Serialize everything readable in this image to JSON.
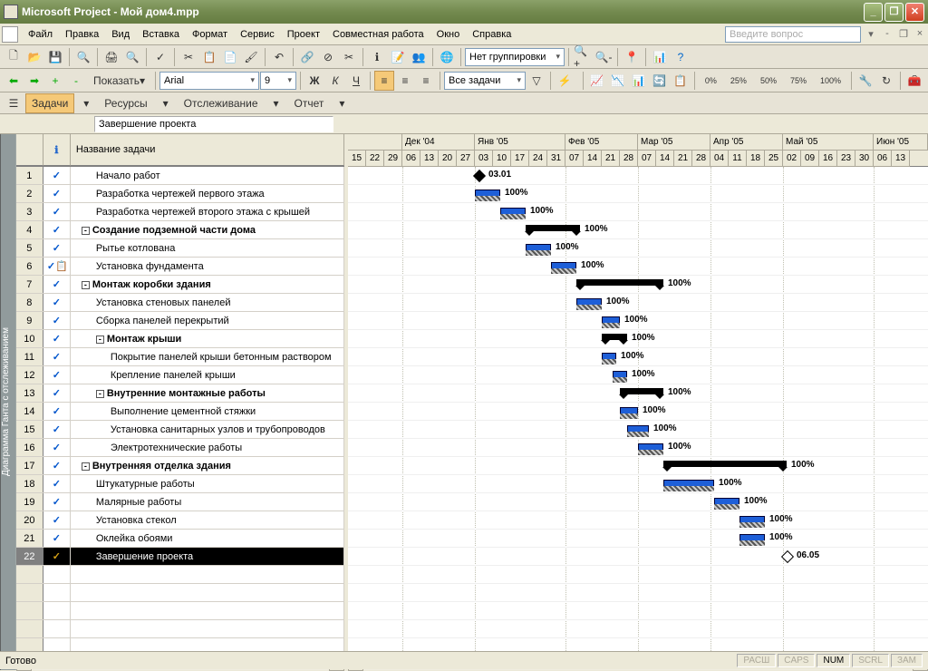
{
  "titlebar": {
    "app": "Microsoft Project",
    "file": "Мой дом4.mpp"
  },
  "menu": [
    "Файл",
    "Правка",
    "Вид",
    "Вставка",
    "Формат",
    "Сервис",
    "Проект",
    "Совместная работа",
    "Окно",
    "Справка"
  ],
  "help_placeholder": "Введите вопрос",
  "toolbar2": {
    "show_label": "Показать",
    "font": "Arial",
    "size": "9",
    "group": "Нет группировки",
    "filter": "Все задачи"
  },
  "percent_buttons": [
    "0%",
    "25%",
    "50%",
    "75%",
    "100%"
  ],
  "viewbar": {
    "tasks": "Задачи",
    "resources": "Ресурсы",
    "tracking": "Отслеживание",
    "report": "Отчет"
  },
  "entry_value": "Завершение проекта",
  "grid": {
    "col_info": "ℹ",
    "col_name": "Название задачи"
  },
  "side_label": "Диаграмма Ганта с отслеживанием",
  "timeline": {
    "months": [
      {
        "label": "",
        "span": 3
      },
      {
        "label": "Дек '04",
        "span": 4
      },
      {
        "label": "Янв '05",
        "span": 5
      },
      {
        "label": "Фев '05",
        "span": 4
      },
      {
        "label": "Мар '05",
        "span": 4
      },
      {
        "label": "Апр '05",
        "span": 4
      },
      {
        "label": "Май '05",
        "span": 5
      },
      {
        "label": "Июн '05",
        "span": 3
      }
    ],
    "days": [
      "15",
      "22",
      "29",
      "06",
      "13",
      "20",
      "27",
      "03",
      "10",
      "17",
      "24",
      "31",
      "07",
      "14",
      "21",
      "28",
      "07",
      "14",
      "21",
      "28",
      "04",
      "11",
      "18",
      "25",
      "02",
      "09",
      "16",
      "23",
      "30",
      "06",
      "13"
    ],
    "day_width": 20
  },
  "tasks": [
    {
      "id": 1,
      "name": "Начало работ",
      "indent": 1,
      "bold": false,
      "type": "milestone",
      "start": 7,
      "label": "03.01"
    },
    {
      "id": 2,
      "name": "Разработка чертежей первого этажа",
      "indent": 1,
      "bold": false,
      "type": "task",
      "start": 7,
      "dur": 1.4,
      "pct": "100%"
    },
    {
      "id": 3,
      "name": "Разработка чертежей второго этажа с крышей",
      "indent": 1,
      "bold": false,
      "type": "task",
      "start": 8.4,
      "dur": 1.4,
      "pct": "100%"
    },
    {
      "id": 4,
      "name": "Создание подземной части дома",
      "indent": 0,
      "bold": true,
      "type": "summary",
      "start": 9.8,
      "dur": 3.0,
      "pct": "100%",
      "outline": "-"
    },
    {
      "id": 5,
      "name": "Рытье котлована",
      "indent": 1,
      "bold": false,
      "type": "task",
      "start": 9.8,
      "dur": 1.4,
      "pct": "100%"
    },
    {
      "id": 6,
      "name": "Установка фундамента",
      "indent": 1,
      "bold": false,
      "type": "task",
      "start": 11.2,
      "dur": 1.4,
      "pct": "100%",
      "icon": "note"
    },
    {
      "id": 7,
      "name": "Монтаж коробки здания",
      "indent": 0,
      "bold": true,
      "type": "summary",
      "start": 12.6,
      "dur": 4.8,
      "pct": "100%",
      "outline": "-"
    },
    {
      "id": 8,
      "name": "Установка стеновых панелей",
      "indent": 1,
      "bold": false,
      "type": "task",
      "start": 12.6,
      "dur": 1.4,
      "pct": "100%"
    },
    {
      "id": 9,
      "name": "Сборка панелей перекрытий",
      "indent": 1,
      "bold": false,
      "type": "task",
      "start": 14.0,
      "dur": 1.0,
      "pct": "100%"
    },
    {
      "id": 10,
      "name": "Монтаж крыши",
      "indent": 1,
      "bold": true,
      "type": "summary",
      "start": 14.0,
      "dur": 1.4,
      "pct": "100%",
      "outline": "-"
    },
    {
      "id": 11,
      "name": "Покрытие панелей крыши бетонным раствором",
      "indent": 2,
      "bold": false,
      "type": "task",
      "start": 14.0,
      "dur": 0.8,
      "pct": "100%"
    },
    {
      "id": 12,
      "name": "Крепление панелей крыши",
      "indent": 2,
      "bold": false,
      "type": "task",
      "start": 14.6,
      "dur": 0.8,
      "pct": "100%"
    },
    {
      "id": 13,
      "name": "Внутренние монтажные работы",
      "indent": 1,
      "bold": true,
      "type": "summary",
      "start": 15.0,
      "dur": 2.4,
      "pct": "100%",
      "outline": "-"
    },
    {
      "id": 14,
      "name": "Выполнение цементной стяжки",
      "indent": 2,
      "bold": false,
      "type": "task",
      "start": 15.0,
      "dur": 1.0,
      "pct": "100%"
    },
    {
      "id": 15,
      "name": "Установка санитарных узлов и трубопроводов",
      "indent": 2,
      "bold": false,
      "type": "task",
      "start": 15.4,
      "dur": 1.2,
      "pct": "100%"
    },
    {
      "id": 16,
      "name": "Электротехнические работы",
      "indent": 2,
      "bold": false,
      "type": "task",
      "start": 16.0,
      "dur": 1.4,
      "pct": "100%"
    },
    {
      "id": 17,
      "name": "Внутренняя отделка здания",
      "indent": 0,
      "bold": true,
      "type": "summary",
      "start": 17.4,
      "dur": 6.8,
      "pct": "100%",
      "outline": "-"
    },
    {
      "id": 18,
      "name": "Штукатурные работы",
      "indent": 1,
      "bold": false,
      "type": "task",
      "start": 17.4,
      "dur": 2.8,
      "pct": "100%"
    },
    {
      "id": 19,
      "name": "Малярные работы",
      "indent": 1,
      "bold": false,
      "type": "task",
      "start": 20.2,
      "dur": 1.4,
      "pct": "100%"
    },
    {
      "id": 20,
      "name": "Установка стекол",
      "indent": 1,
      "bold": false,
      "type": "task",
      "start": 21.6,
      "dur": 1.4,
      "pct": "100%"
    },
    {
      "id": 21,
      "name": "Оклейка обоями",
      "indent": 1,
      "bold": false,
      "type": "task",
      "start": 21.6,
      "dur": 1.4,
      "pct": "100%"
    },
    {
      "id": 22,
      "name": "Завершение проекта",
      "indent": 1,
      "bold": false,
      "type": "milestone",
      "start": 24.0,
      "label": "06.05",
      "selected": true
    }
  ],
  "statusbar": {
    "ready": "Готово",
    "ext": "РАСШ",
    "caps": "CAPS",
    "num": "NUM",
    "scrl": "SCRL",
    "ovr": "ЗАМ"
  },
  "chart_data": {
    "type": "gantt",
    "title": "Диаграмма Ганта с отслеживанием — Мой дом4.mpp",
    "time_axis": {
      "start": "2004-11-15",
      "end": "2005-06-13",
      "unit": "week"
    },
    "tasks": [
      {
        "id": 1,
        "name": "Начало работ",
        "type": "milestone",
        "date": "2005-01-03",
        "complete": 100
      },
      {
        "id": 2,
        "name": "Разработка чертежей первого этажа",
        "type": "task",
        "start": "2005-01-03",
        "end": "2005-01-12",
        "complete": 100
      },
      {
        "id": 3,
        "name": "Разработка чертежей второго этажа с крышей",
        "type": "task",
        "start": "2005-01-12",
        "end": "2005-01-21",
        "complete": 100
      },
      {
        "id": 4,
        "name": "Создание подземной части дома",
        "type": "summary",
        "start": "2005-01-21",
        "end": "2005-02-11",
        "complete": 100
      },
      {
        "id": 5,
        "name": "Рытье котлована",
        "type": "task",
        "start": "2005-01-21",
        "end": "2005-01-31",
        "complete": 100
      },
      {
        "id": 6,
        "name": "Установка фундамента",
        "type": "task",
        "start": "2005-01-31",
        "end": "2005-02-11",
        "complete": 100
      },
      {
        "id": 7,
        "name": "Монтаж коробки здания",
        "type": "summary",
        "start": "2005-02-11",
        "end": "2005-03-17",
        "complete": 100
      },
      {
        "id": 8,
        "name": "Установка стеновых панелей",
        "type": "task",
        "start": "2005-02-11",
        "end": "2005-02-21",
        "complete": 100
      },
      {
        "id": 9,
        "name": "Сборка панелей перекрытий",
        "type": "task",
        "start": "2005-02-21",
        "end": "2005-02-28",
        "complete": 100
      },
      {
        "id": 10,
        "name": "Монтаж крыши",
        "type": "summary",
        "start": "2005-02-21",
        "end": "2005-03-04",
        "complete": 100
      },
      {
        "id": 11,
        "name": "Покрытие панелей крыши бетонным раствором",
        "type": "task",
        "start": "2005-02-21",
        "end": "2005-02-26",
        "complete": 100
      },
      {
        "id": 12,
        "name": "Крепление панелей крыши",
        "type": "task",
        "start": "2005-02-25",
        "end": "2005-03-04",
        "complete": 100
      },
      {
        "id": 13,
        "name": "Внутренние монтажные работы",
        "type": "summary",
        "start": "2005-02-28",
        "end": "2005-03-17",
        "complete": 100
      },
      {
        "id": 14,
        "name": "Выполнение цементной стяжки",
        "type": "task",
        "start": "2005-02-28",
        "end": "2005-03-07",
        "complete": 100
      },
      {
        "id": 15,
        "name": "Установка санитарных узлов и трубопроводов",
        "type": "task",
        "start": "2005-03-03",
        "end": "2005-03-11",
        "complete": 100
      },
      {
        "id": 16,
        "name": "Электротехнические работы",
        "type": "task",
        "start": "2005-03-07",
        "end": "2005-03-17",
        "complete": 100
      },
      {
        "id": 17,
        "name": "Внутренняя отделка здания",
        "type": "summary",
        "start": "2005-03-17",
        "end": "2005-05-06",
        "complete": 100
      },
      {
        "id": 18,
        "name": "Штукатурные работы",
        "type": "task",
        "start": "2005-03-17",
        "end": "2005-04-06",
        "complete": 100
      },
      {
        "id": 19,
        "name": "Малярные работы",
        "type": "task",
        "start": "2005-04-06",
        "end": "2005-04-18",
        "complete": 100
      },
      {
        "id": 20,
        "name": "Установка стекол",
        "type": "task",
        "start": "2005-04-18",
        "end": "2005-04-28",
        "complete": 100
      },
      {
        "id": 21,
        "name": "Оклейка обоями",
        "type": "task",
        "start": "2005-04-18",
        "end": "2005-04-28",
        "complete": 100
      },
      {
        "id": 22,
        "name": "Завершение проекта",
        "type": "milestone",
        "date": "2005-05-06",
        "complete": 100
      }
    ]
  }
}
